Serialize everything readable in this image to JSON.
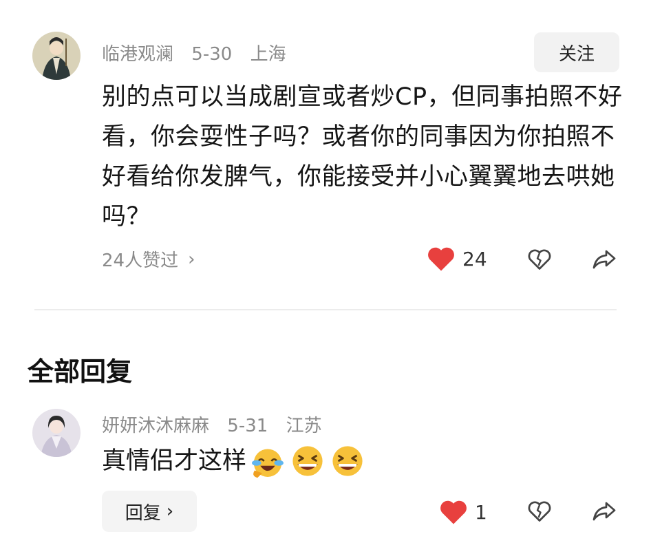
{
  "comment": {
    "username": "临港观澜",
    "date": "5-30",
    "location": "上海",
    "follow_label": "关注",
    "text": "别的点可以当成剧宣或者炒CP，但同事拍照不好看，你会耍性子吗？或者你的同事因为你拍照不好看给你发脾气，你能接受并小心翼翼地去哄她吗？",
    "liked_by": "24人赞过",
    "like_count": "24",
    "avatar_icon": "man-in-robe-avatar"
  },
  "replies_section": {
    "title": "全部回复"
  },
  "reply": {
    "username": "妍妍沐沐麻麻",
    "date": "5-31",
    "location": "江苏",
    "text": "真情侣才这样",
    "emojis": [
      "laughing-crying-emoji",
      "grinning-squint-emoji",
      "grinning-squint-emoji"
    ],
    "reply_label": "回复",
    "like_count": "1",
    "avatar_icon": "woman-in-robe-avatar"
  },
  "colors": {
    "like_red": "#e8403e",
    "meta_gray": "#8a8a8a",
    "button_bg": "#f2f2f2"
  }
}
